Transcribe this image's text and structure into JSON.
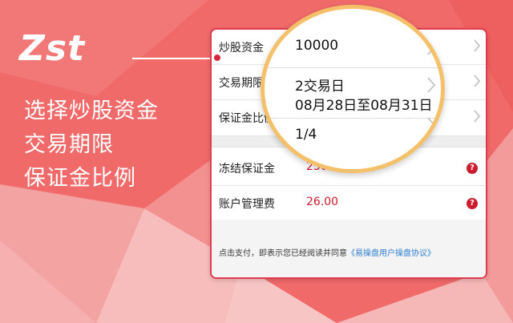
{
  "brand": {
    "logo_text": "Zst"
  },
  "features": [
    "选择炒股资金",
    "交易期限",
    "保证金比例"
  ],
  "form": {
    "rows": [
      {
        "label": "炒股资金"
      },
      {
        "label": "交易期限"
      },
      {
        "label": "保证金比例"
      }
    ],
    "fees": [
      {
        "label": "冻结保证金",
        "value": "2500.00"
      },
      {
        "label": "账户管理费",
        "value": "26.00"
      }
    ],
    "notice_text": "点击支付，即表示您已经阅读并同意",
    "notice_link": "《易操盘用户操盘协议》"
  },
  "magnifier": {
    "amount": "10000",
    "term": "2交易日",
    "term_dates": "08月28日至08月31日",
    "ratio": "1/4"
  },
  "colors": {
    "background": "#f06a6a",
    "accent_red": "#cc1b2f",
    "magnifier_ring": "#f5c06a",
    "link": "#2f7fd0"
  }
}
